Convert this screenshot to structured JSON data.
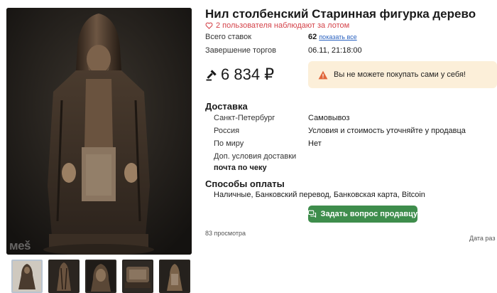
{
  "photo": {
    "watermark": "мeš"
  },
  "thumbnails": [
    {
      "name": "thumb-figure-front"
    },
    {
      "name": "thumb-figure-side"
    },
    {
      "name": "thumb-figure-head"
    },
    {
      "name": "thumb-figure-base"
    },
    {
      "name": "thumb-figure-back"
    }
  ],
  "lot": {
    "title": "Нил столбенский Старинная фигурка дерево",
    "watchers": "2 пользователя наблюдают за лотом",
    "bids_label": "Всего ставок",
    "bids_count": "62",
    "bids_link": "показать все",
    "end_label": "Завершение торгов",
    "end_value": "06.11, 21:18:00",
    "price": "6 834 ₽",
    "notice": "Вы не можете покупать сами у себя!"
  },
  "delivery": {
    "heading": "Доставка",
    "rows": [
      {
        "label": "Санкт-Петербург",
        "value": "Самовывоз"
      },
      {
        "label": "Россия",
        "value": "Условия и стоимость уточняйте у продавца"
      },
      {
        "label": "По миру",
        "value": "Нет"
      }
    ],
    "extra_label": "Доп. условия доставки",
    "extra_value": "почта по чеку"
  },
  "payment": {
    "heading": "Способы оплаты",
    "methods": "Наличные, Банковский перевод, Банковская карта, Bitcoin"
  },
  "actions": {
    "ask_seller": "Задать вопрос продавцу"
  },
  "footer": {
    "views": "83 просмотра",
    "date_label": "Дата раз"
  },
  "colors": {
    "accent_green": "#3e8d4c",
    "watch_red": "#d4434a",
    "notice_bg": "#fcefd9",
    "link_blue": "#2a62c0"
  },
  "icons": [
    "heart-outline-icon",
    "gavel-icon",
    "warning-icon",
    "chat-icon"
  ]
}
